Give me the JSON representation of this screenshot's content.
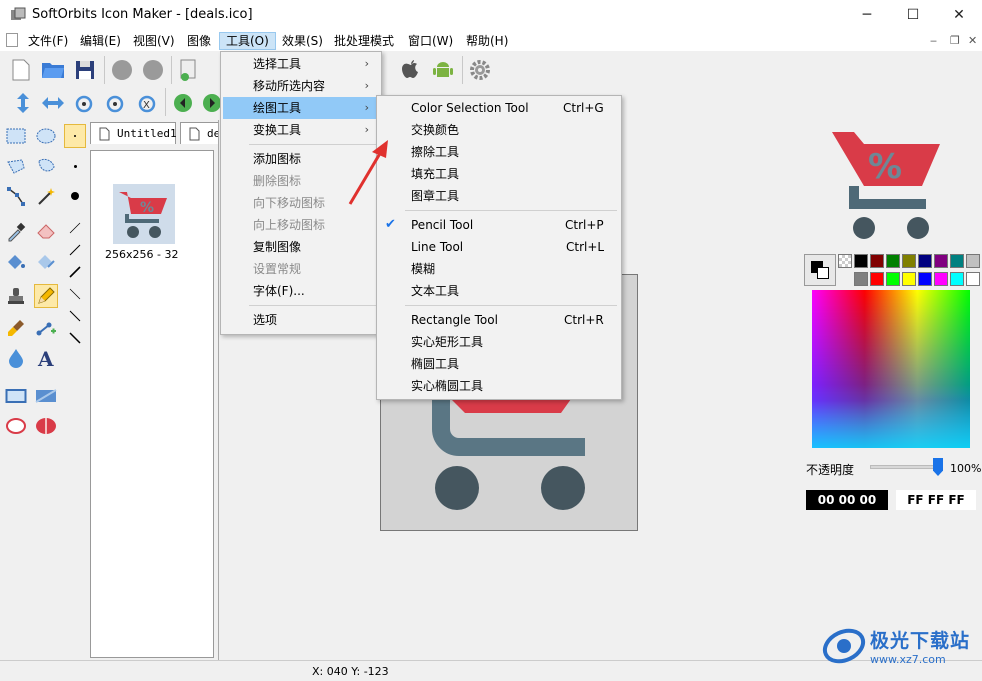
{
  "window": {
    "title": "SoftOrbits Icon Maker - [deals.ico]",
    "minimize": "─",
    "maximize": "☐",
    "close": "✕"
  },
  "menubar": {
    "items": [
      "文件(F)",
      "编辑(E)",
      "视图(V)",
      "图像",
      "工具(O)",
      "效果(S)",
      "批处理模式",
      "窗口(W)",
      "帮助(H)"
    ],
    "active": "工具(O)",
    "mdi_min": "‒",
    "mdi_restore": "❐",
    "mdi_close": "✕"
  },
  "tools_menu": {
    "items": [
      {
        "label": "选择工具",
        "submenu": true,
        "enabled": true
      },
      {
        "label": "移动所选内容",
        "submenu": true,
        "enabled": true
      },
      {
        "label": "绘图工具",
        "submenu": true,
        "enabled": true,
        "highlighted": true
      },
      {
        "label": "变换工具",
        "submenu": true,
        "enabled": true
      },
      {
        "label": "添加图标",
        "enabled": true
      },
      {
        "label": "删除图标",
        "enabled": false
      },
      {
        "label": "向下移动图标",
        "enabled": false
      },
      {
        "label": "向上移动图标",
        "enabled": false
      },
      {
        "label": "复制图像",
        "enabled": true
      },
      {
        "label": "设置常规",
        "enabled": false
      },
      {
        "label": "字体(F)...",
        "enabled": true
      },
      {
        "label": "选项",
        "enabled": true
      }
    ]
  },
  "drawing_submenu": {
    "items": [
      {
        "label": "Color Selection Tool",
        "shortcut": "Ctrl+G"
      },
      {
        "label": "交换颜色",
        "shortcut": ""
      },
      {
        "label": "擦除工具",
        "shortcut": ""
      },
      {
        "label": "填充工具",
        "shortcut": ""
      },
      {
        "label": "图章工具",
        "shortcut": ""
      },
      {
        "label": "Pencil Tool",
        "shortcut": "Ctrl+P",
        "checked": true
      },
      {
        "label": "Line Tool",
        "shortcut": "Ctrl+L"
      },
      {
        "label": "模糊",
        "shortcut": ""
      },
      {
        "label": "文本工具",
        "shortcut": ""
      },
      {
        "label": "Rectangle Tool",
        "shortcut": "Ctrl+R"
      },
      {
        "label": "实心矩形工具",
        "shortcut": ""
      },
      {
        "label": "椭圆工具",
        "shortcut": ""
      },
      {
        "label": "实心椭圆工具",
        "shortcut": ""
      }
    ]
  },
  "documents": {
    "tabs": [
      "Untitled1",
      "de"
    ],
    "thumbnail_label": "256x256 - 32"
  },
  "right_panel": {
    "opacity_label": "不透明度",
    "opacity_value": "100%",
    "opacity_fraction": 1.0,
    "color_hex_primary": "00 00 00",
    "color_hex_secondary": "FF FF FF",
    "palette_row1": [
      "#000000",
      "#800000",
      "#008000",
      "#808000",
      "#000080",
      "#800080",
      "#008080",
      "#c0c0c0"
    ],
    "palette_row2": [
      "#808080",
      "#ff0000",
      "#00ff00",
      "#ffff00",
      "#0000ff",
      "#ff00ff",
      "#00ffff",
      "#ffffff"
    ]
  },
  "status": {
    "coords": "X: 040 Y: -123"
  },
  "watermark": {
    "text": "极光下载站",
    "url": "www.xz7.com"
  },
  "colors": {
    "cart_red": "#d93b48",
    "cart_gray": "#4e6977",
    "wheel_dark": "#45565f",
    "menu_highlight": "#91c9f7",
    "arrow_red": "#e0312e"
  }
}
